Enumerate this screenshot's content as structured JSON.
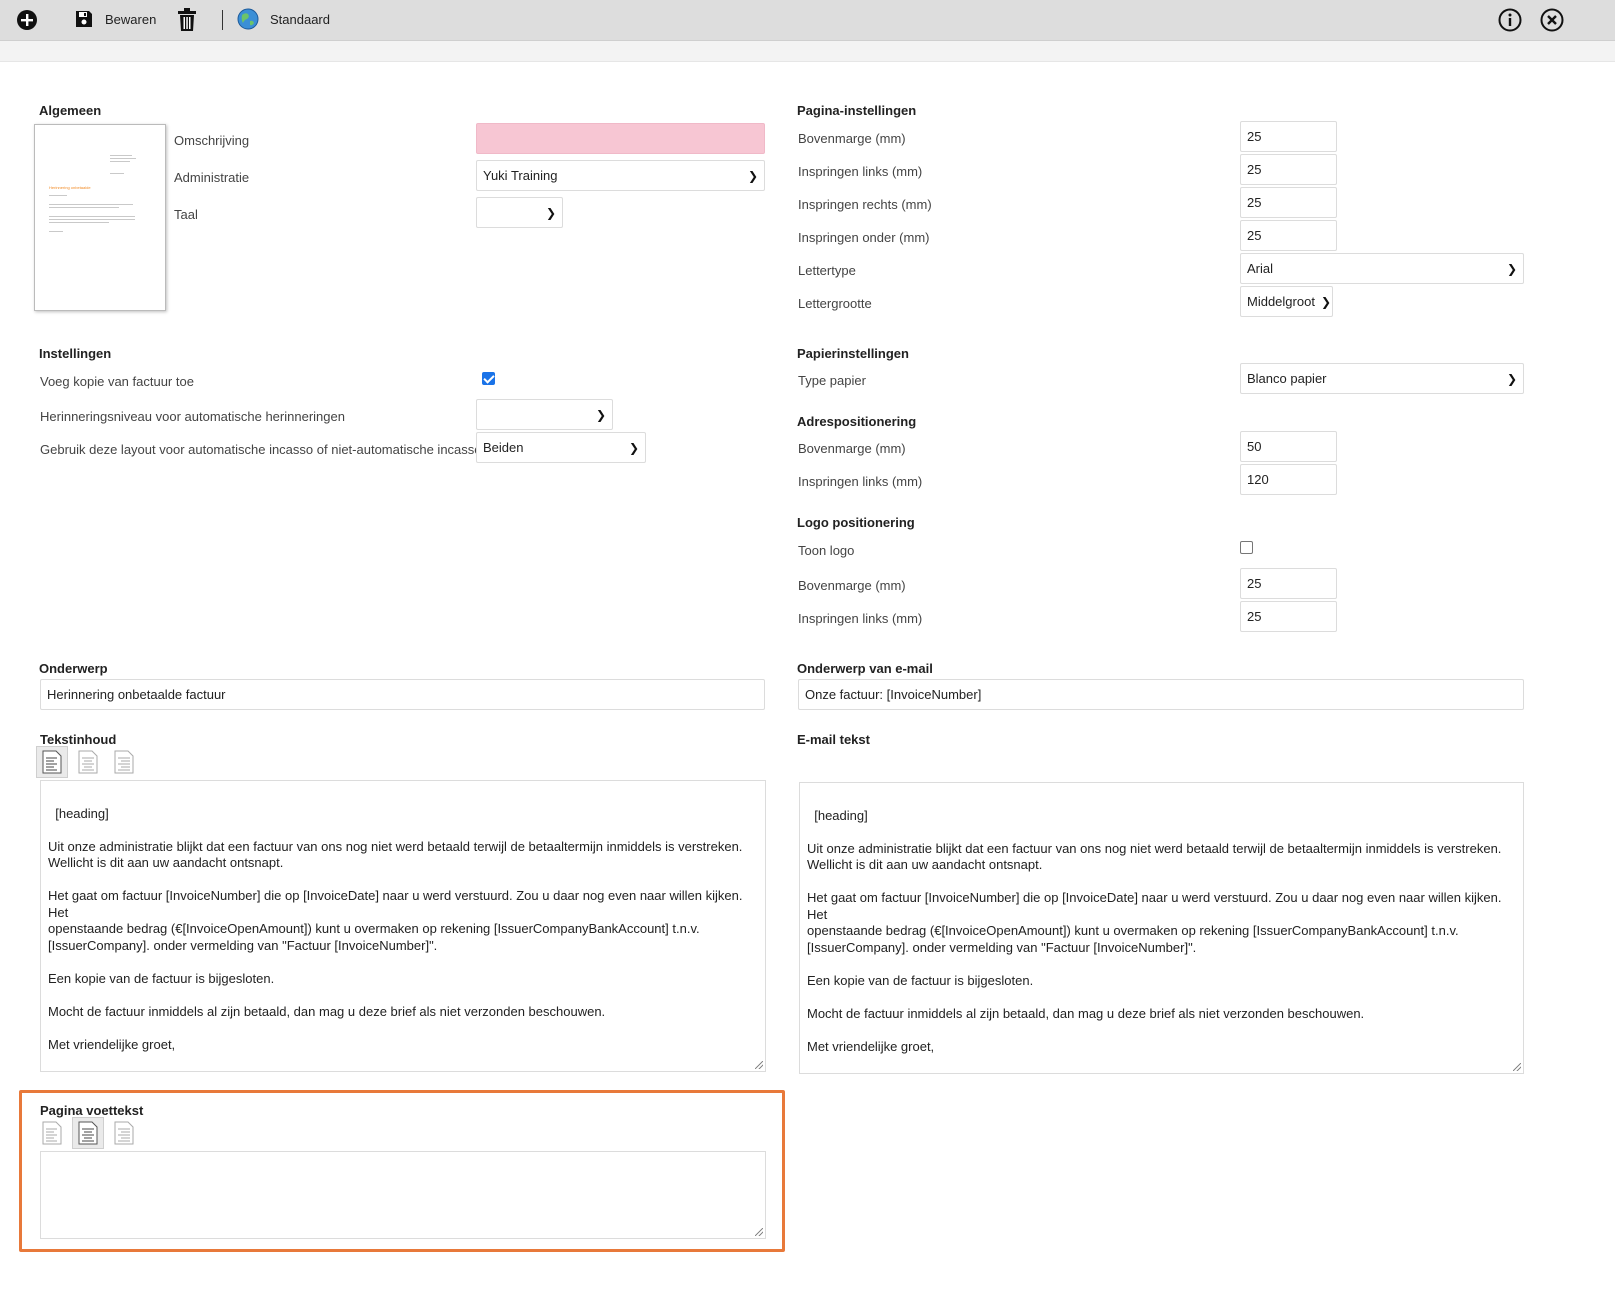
{
  "toolbar": {
    "save_label": "Bewaren",
    "default_label": "Standaard"
  },
  "algemeen": {
    "heading": "Algemeen",
    "omschrijving_label": "Omschrijving",
    "omschrijving_value": "",
    "administratie_label": "Administratie",
    "administratie_value": "Yuki Training",
    "taal_label": "Taal",
    "taal_value": "",
    "preview_title": "Herinnering onbetaalde"
  },
  "instellingen": {
    "heading": "Instellingen",
    "kopie_label": "Voeg kopie van factuur toe",
    "kopie_checked": true,
    "niveau_label": "Herinneringsniveau voor automatische herinneringen",
    "niveau_value": "",
    "incasso_label": "Gebruik deze layout voor automatische incasso of niet-automatische incasso?",
    "incasso_value": "Beiden"
  },
  "pagina": {
    "heading": "Pagina-instellingen",
    "fields": [
      {
        "label": "Bovenmarge (mm)",
        "value": "25"
      },
      {
        "label": "Inspringen links (mm)",
        "value": "25"
      },
      {
        "label": "Inspringen rechts (mm)",
        "value": "25"
      },
      {
        "label": "Inspringen onder (mm)",
        "value": "25"
      }
    ],
    "lettertype_label": "Lettertype",
    "lettertype_value": "Arial",
    "lettergrootte_label": "Lettergrootte",
    "lettergrootte_value": "Middelgroot"
  },
  "papier": {
    "heading": "Papierinstellingen",
    "type_label": "Type papier",
    "type_value": "Blanco papier"
  },
  "adres": {
    "heading": "Adrespositionering",
    "boven_label": "Bovenmarge (mm)",
    "boven_value": "50",
    "links_label": "Inspringen links (mm)",
    "links_value": "120"
  },
  "logo": {
    "heading": "Logo positionering",
    "toon_label": "Toon logo",
    "toon_checked": false,
    "boven_label": "Bovenmarge (mm)",
    "boven_value": "25",
    "links_label": "Inspringen links (mm)",
    "links_value": "25"
  },
  "onderwerp": {
    "heading": "Onderwerp",
    "value": "Herinnering onbetaalde factuur"
  },
  "email_onderwerp": {
    "heading": "Onderwerp van e-mail",
    "value": "Onze factuur: [InvoiceNumber]"
  },
  "tekstinhoud": {
    "heading": "Tekstinhoud",
    "text": "[heading]\n\nUit onze administratie blijkt dat een factuur van ons nog niet werd betaald terwijl de betaaltermijn inmiddels is verstreken.\nWellicht is dit aan uw aandacht ontsnapt.\n\nHet gaat om factuur [InvoiceNumber] die op [InvoiceDate] naar u werd verstuurd. Zou u daar nog even naar willen kijken. Het\nopenstaande bedrag (€[InvoiceOpenAmount]) kunt u overmaken op rekening [IssuerCompanyBankAccount] t.n.v.\n[IssuerCompany]. onder vermelding van \"Factuur [InvoiceNumber]\".\n\nEen kopie van de factuur is bijgesloten.\n\nMocht de factuur inmiddels al zijn betaald, dan mag u deze brief als niet verzonden beschouwen.\n\nMet vriendelijke groet,\n\n[IssuerCompany]"
  },
  "email_tekst": {
    "heading": "E-mail tekst",
    "text": "[heading]\n\nUit onze administratie blijkt dat een factuur van ons nog niet werd betaald terwijl de betaaltermijn inmiddels is verstreken.\nWellicht is dit aan uw aandacht ontsnapt.\n\nHet gaat om factuur [InvoiceNumber] die op [InvoiceDate] naar u werd verstuurd. Zou u daar nog even naar willen kijken. Het\nopenstaande bedrag (€[InvoiceOpenAmount]) kunt u overmaken op rekening [IssuerCompanyBankAccount] t.n.v.\n[IssuerCompany]. onder vermelding van \"Factuur [InvoiceNumber]\".\n\nEen kopie van de factuur is bijgesloten.\n\nMocht de factuur inmiddels al zijn betaald, dan mag u deze brief als niet verzonden beschouwen.\n\nMet vriendelijke groet,\n\n[IssuerCompany]"
  },
  "voettekst": {
    "heading": "Pagina voettekst",
    "text": ""
  },
  "colors": {
    "highlight": "#e8793a",
    "required_field": "#f7c6d3",
    "checkbox": "#1a73e8"
  },
  "icons": [
    "add-icon",
    "save-icon",
    "trash-icon",
    "globe-icon",
    "info-icon",
    "close-icon",
    "align-left-icon",
    "align-center-icon",
    "align-right-icon"
  ]
}
